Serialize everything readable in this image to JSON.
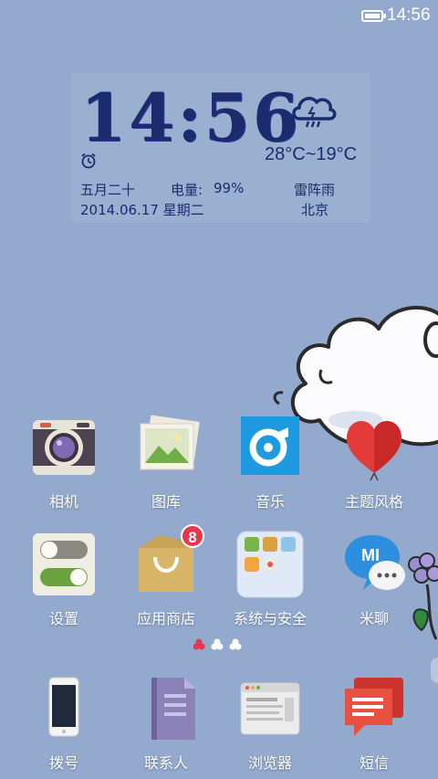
{
  "status_bar": {
    "time": "14:56"
  },
  "widget": {
    "time": "14:56",
    "temperature": "28°C~19°C",
    "lunar_date": "五月二十",
    "battery_label": "电量:",
    "battery_value": "99%",
    "weather": "雷阵雨",
    "date": "2014.06.17 星期二",
    "city": "北京",
    "icons": [
      "alarm-clock-icon",
      "thunderstorm-cloud-icon"
    ]
  },
  "apps_row1": [
    {
      "label": "相机",
      "icon": "camera-icon"
    },
    {
      "label": "图库",
      "icon": "gallery-icon"
    },
    {
      "label": "音乐",
      "icon": "music-icon"
    },
    {
      "label": "主题风格",
      "icon": "theme-icon"
    }
  ],
  "apps_row2": [
    {
      "label": "设置",
      "icon": "settings-icon"
    },
    {
      "label": "应用商店",
      "icon": "app-store-icon",
      "badge": "8"
    },
    {
      "label": "系统与安全",
      "icon": "system-security-folder-icon"
    },
    {
      "label": "米聊",
      "icon": "miliao-icon"
    }
  ],
  "dock": [
    {
      "label": "拨号",
      "icon": "phone-icon"
    },
    {
      "label": "联系人",
      "icon": "contacts-icon"
    },
    {
      "label": "浏览器",
      "icon": "browser-icon"
    },
    {
      "label": "短信",
      "icon": "messages-icon"
    }
  ],
  "pages": {
    "count": 3,
    "current": 1
  },
  "colors": {
    "wallpaper": "#93a9cd",
    "widget_text": "#1e2a6e",
    "badge": "#e8364d",
    "active_dot": "#e8364d"
  }
}
